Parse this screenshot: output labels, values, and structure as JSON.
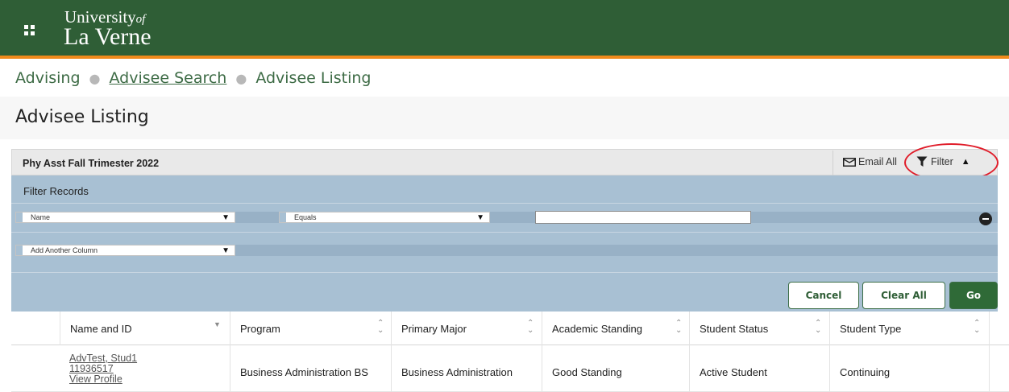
{
  "header": {
    "logo_line1": "University",
    "logo_of": "of",
    "logo_line2": "La Verne"
  },
  "breadcrumb": {
    "items": [
      "Advising",
      "Advisee Search",
      "Advisee Listing"
    ]
  },
  "page_title": "Advisee Listing",
  "panel": {
    "title": "Phy Asst Fall Trimester 2022",
    "email_all": "Email All",
    "filter": "Filter"
  },
  "filter": {
    "heading": "Filter Records",
    "column_value": "Name",
    "operator_value": "Equals",
    "text_value": "",
    "add_column": "Add Another Column",
    "cancel": "Cancel",
    "clear_all": "Clear All",
    "go": "Go"
  },
  "table": {
    "columns": [
      "Name and ID",
      "Program",
      "Primary Major",
      "Academic Standing",
      "Student Status",
      "Student Type"
    ],
    "rows": [
      {
        "name": "AdvTest, Stud1",
        "id": "11936517",
        "view": "View Profile",
        "program": "Business Administration BS",
        "major": "Business Administration",
        "standing": "Good Standing",
        "status": "Active Student",
        "type": "Continuing"
      }
    ]
  },
  "colors": {
    "header_green": "#2f5e36",
    "accent_orange": "#f08a1c",
    "filter_blue": "#a8c0d3",
    "highlight_red": "#e01d2a"
  }
}
